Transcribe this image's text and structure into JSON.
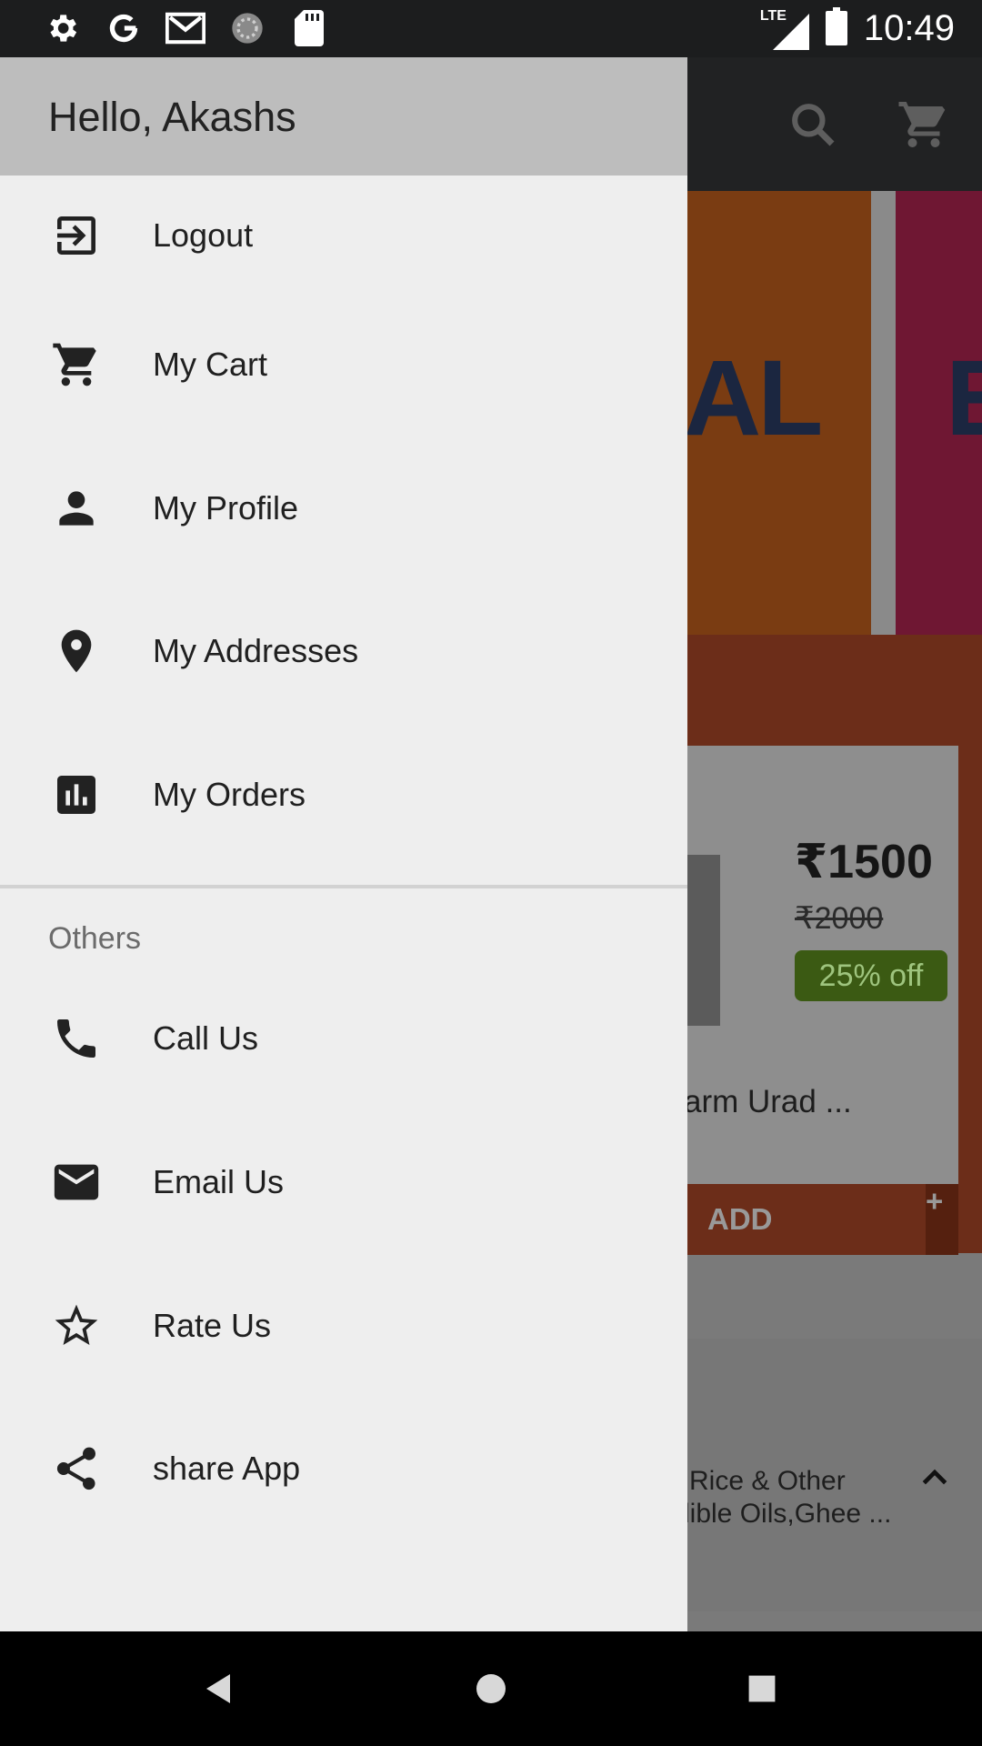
{
  "status_bar": {
    "time": "10:49",
    "network": "LTE",
    "icons": [
      "settings-icon",
      "google-icon",
      "gmail-icon",
      "loading-icon",
      "sd-card-icon"
    ]
  },
  "app": {
    "toolbar_icons": [
      "search-icon",
      "cart-icon"
    ],
    "banner_text": "AL",
    "banner_text_2": "E",
    "product": {
      "price": "₹1500",
      "mrp": "₹2000",
      "discount": "25% off",
      "name": "arm Urad ...",
      "add_label": "ADD",
      "plus_label": "+"
    },
    "category": {
      "line1": "Rice & Other",
      "line2": "lible Oils,Ghee ..."
    }
  },
  "drawer": {
    "greeting": "Hello, Akashs",
    "items": [
      {
        "label": "Logout",
        "icon": "logout-icon"
      },
      {
        "label": "My Cart",
        "icon": "cart-icon"
      },
      {
        "label": "My Profile",
        "icon": "person-icon"
      },
      {
        "label": "My Addresses",
        "icon": "location-pin-icon"
      },
      {
        "label": "My Orders",
        "icon": "bar-chart-icon"
      }
    ],
    "section_title": "Others",
    "other_items": [
      {
        "label": "Call Us",
        "icon": "phone-icon"
      },
      {
        "label": "Email Us",
        "icon": "mail-icon"
      },
      {
        "label": "Rate Us",
        "icon": "star-outline-icon"
      },
      {
        "label": "share App",
        "icon": "share-icon"
      }
    ]
  },
  "colors": {
    "drawer_bg": "#eeeeee",
    "drawer_header": "#bdbdbd",
    "accent_discount": "#3b5a13",
    "promo_bg": "#6c2d19"
  }
}
